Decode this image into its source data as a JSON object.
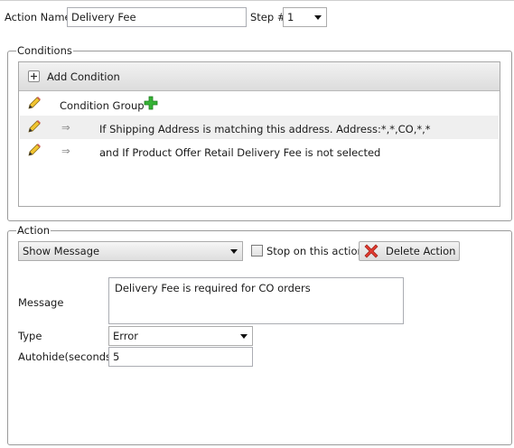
{
  "header": {
    "action_name_label": "Action Name",
    "action_name_value": "Delivery Fee",
    "step_label": "Step #",
    "step_value": "1"
  },
  "conditions": {
    "legend": "Conditions",
    "add_condition_label": "Add Condition",
    "rows": [
      {
        "text": "Condition Group"
      },
      {
        "text": "If Shipping Address is matching this address. Address:*,*,CO,*,*"
      },
      {
        "text": "and If Product Offer Retail Delivery Fee is not selected"
      }
    ]
  },
  "action": {
    "legend": "Action",
    "action_type": "Show Message",
    "stop_label": "Stop on this action",
    "stop_checked": false,
    "delete_label": "Delete Action",
    "message_label": "Message",
    "message_value": "Delivery Fee is required for CO orders",
    "type_label": "Type",
    "type_value": "Error",
    "autohide_label": "Autohide(seconds)",
    "autohide_value": "5"
  },
  "colors": {
    "alt_row": "#efefef",
    "toolbar": "#e4e4e4",
    "plus_green": "#2ea82e",
    "delete_red": "#d93025"
  }
}
